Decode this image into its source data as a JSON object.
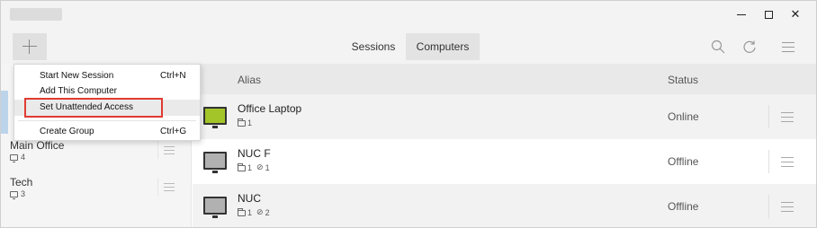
{
  "titlebar": {
    "controls": {
      "minimize": "–",
      "maximize": "□",
      "close": "✕"
    }
  },
  "toolbar": {
    "add_icon": "plus-icon",
    "tabs": [
      {
        "label": "Sessions",
        "active": false
      },
      {
        "label": "Computers",
        "active": true
      }
    ],
    "icons": [
      "search-icon",
      "refresh-icon",
      "menu-icon"
    ]
  },
  "add_menu": {
    "items": [
      {
        "label": "Start New Session",
        "shortcut": "Ctrl+N"
      },
      {
        "label": "Add This Computer",
        "shortcut": ""
      },
      {
        "label": "Set Unattended Access",
        "shortcut": ""
      },
      {
        "label": "Create Group",
        "shortcut": "Ctrl+G"
      }
    ],
    "highlighted": "Set Unattended Access",
    "highlight_color": "#e03b32"
  },
  "sidebar": {
    "groups": [
      {
        "name": "Main Office",
        "count": "4"
      },
      {
        "name": "Tech",
        "count": "3"
      }
    ]
  },
  "list": {
    "columns": {
      "alias": "Alias",
      "status": "Status"
    },
    "rows": [
      {
        "alias": "Office Laptop",
        "folders": "1",
        "tags": "",
        "status": "Online",
        "monitor_color": "#a4c52a"
      },
      {
        "alias": "NUC F",
        "folders": "1",
        "tags": "1",
        "status": "Offline",
        "monitor_color": "#b1b1b1"
      },
      {
        "alias": "NUC",
        "folders": "1",
        "tags": "2",
        "status": "Offline",
        "monitor_color": "#b1b1b1"
      }
    ]
  },
  "colors": {
    "online": "#a4c52a",
    "offline": "#b1b1b1",
    "selection": "#bcd4ea"
  }
}
